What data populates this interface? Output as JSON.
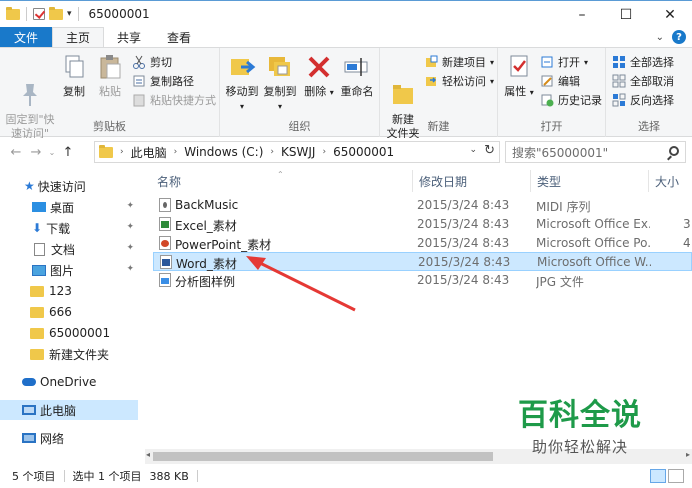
{
  "window": {
    "title": "65000001",
    "controls": [
      "–",
      "☐",
      "✕"
    ]
  },
  "ribbon_tabs": {
    "file": "文件",
    "home": "主页",
    "share": "共享",
    "view": "查看"
  },
  "ribbon": {
    "clipboard": {
      "label": "剪贴板",
      "pin": "固定到\"快\n速访问\"",
      "copy": "复制",
      "paste": "粘贴",
      "cut": "剪切",
      "copy_path": "复制路径",
      "paste_shortcut": "粘贴快捷方式"
    },
    "organize": {
      "label": "组织",
      "move_to": "移动到",
      "copy_to": "复制到",
      "delete": "删除",
      "rename": "重命名"
    },
    "new": {
      "label": "新建",
      "new_folder": "新建\n文件夹",
      "new_item": "新建项目",
      "easy_access": "轻松访问"
    },
    "open": {
      "label": "打开",
      "properties": "属性",
      "open": "打开",
      "edit": "编辑",
      "history": "历史记录"
    },
    "select": {
      "label": "选择",
      "select_all": "全部选择",
      "select_none": "全部取消",
      "invert": "反向选择"
    }
  },
  "address": {
    "crumbs": [
      "此电脑",
      "Windows (C:)",
      "KSWJJ",
      "65000001"
    ],
    "search_placeholder": "搜索\"65000001\""
  },
  "nav": {
    "quick_access": "快速访问",
    "items": [
      {
        "label": "桌面",
        "pinned": true
      },
      {
        "label": "下载",
        "pinned": true
      },
      {
        "label": "文档",
        "pinned": true
      },
      {
        "label": "图片",
        "pinned": true
      },
      {
        "label": "123"
      },
      {
        "label": "666"
      },
      {
        "label": "65000001"
      },
      {
        "label": "新建文件夹"
      }
    ],
    "onedrive": "OneDrive",
    "this_pc": "此电脑",
    "network": "网络"
  },
  "columns": {
    "name": "名称",
    "date": "修改日期",
    "type": "类型",
    "size": "大小"
  },
  "files": [
    {
      "name": "BackMusic",
      "date": "2015/3/24 8:43",
      "type": "MIDI 序列",
      "size": "",
      "icon": "midi"
    },
    {
      "name": "Excel_素材",
      "date": "2015/3/24 8:43",
      "type": "Microsoft Office Ex...",
      "size": "3",
      "icon": "excel"
    },
    {
      "name": "PowerPoint_素材",
      "date": "2015/3/24 8:43",
      "type": "Microsoft Office Po...",
      "size": "4",
      "icon": "ppt"
    },
    {
      "name": "Word_素材",
      "date": "2015/3/24 8:43",
      "type": "Microsoft Office W...",
      "size": "",
      "icon": "word",
      "selected": true
    },
    {
      "name": "分析图样例",
      "date": "2015/3/24 8:43",
      "type": "JPG 文件",
      "size": "",
      "icon": "jpg"
    }
  ],
  "status": {
    "count": "5 个项目",
    "selected": "选中 1 个项目",
    "size": "388 KB"
  },
  "watermark": {
    "title": "百科全说",
    "subtitle": "助你轻松解决"
  },
  "colors": {
    "accent": "#1979ca",
    "selection": "#cce8ff",
    "annotation_arrow": "#e53935",
    "watermark_green": "#1e9a49"
  }
}
